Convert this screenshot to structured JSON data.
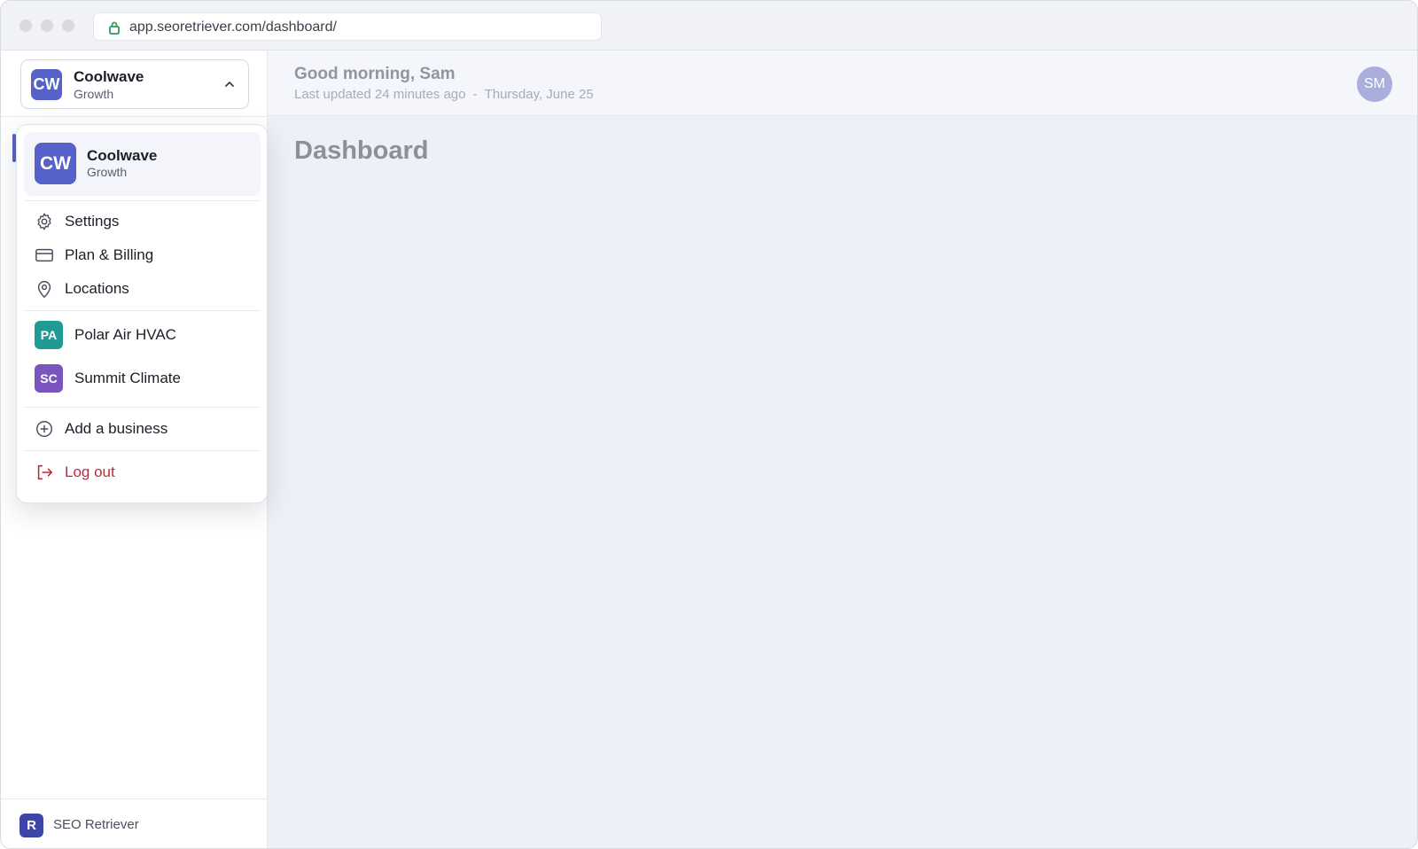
{
  "browser": {
    "url": "app.seoretriever.com/dashboard/"
  },
  "sidebar": {
    "switcher": {
      "initials": "CW",
      "name": "Coolwave",
      "plan": "Growth"
    },
    "footer": {
      "logo_letter": "R",
      "brand": "SEO Retriever"
    }
  },
  "header": {
    "greeting": "Good morning, Sam",
    "updated": "Last updated 24 minutes ago",
    "separator": "-",
    "date": "Thursday, June 25",
    "user_initials": "SM"
  },
  "main": {
    "title": "Dashboard"
  },
  "dropdown": {
    "current": {
      "initials": "CW",
      "name": "Coolwave",
      "plan": "Growth"
    },
    "items": [
      {
        "label": "Settings",
        "icon": "gear-icon"
      },
      {
        "label": "Plan & Billing",
        "icon": "credit-card-icon"
      },
      {
        "label": "Locations",
        "icon": "map-pin-icon"
      }
    ],
    "businesses": [
      {
        "initials": "PA",
        "name": "Polar Air HVAC",
        "color": "#1f9a94"
      },
      {
        "initials": "SC",
        "name": "Summit Climate",
        "color": "#7a55bd"
      }
    ],
    "add_business": "Add a business",
    "logout": "Log out"
  },
  "colors": {
    "brand": "#5562c9",
    "danger": "#c0283a"
  }
}
